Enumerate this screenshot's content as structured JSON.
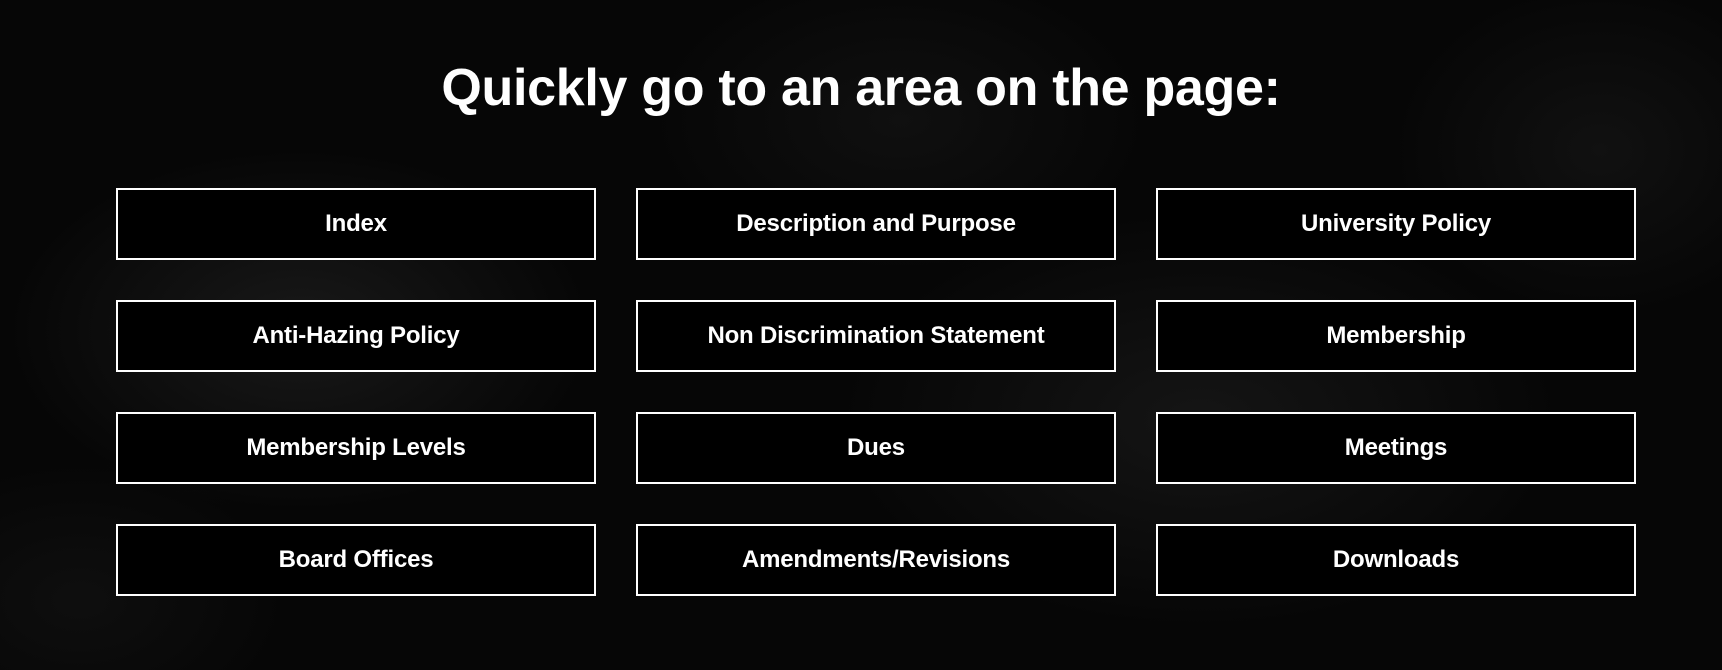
{
  "heading": "Quickly go to an area on the page:",
  "nav_buttons": [
    {
      "label": "Index"
    },
    {
      "label": "Description and Purpose"
    },
    {
      "label": "University Policy"
    },
    {
      "label": "Anti-Hazing Policy"
    },
    {
      "label": "Non Discrimination Statement"
    },
    {
      "label": "Membership"
    },
    {
      "label": "Membership Levels"
    },
    {
      "label": "Dues"
    },
    {
      "label": "Meetings"
    },
    {
      "label": "Board Offices"
    },
    {
      "label": "Amendments/Revisions"
    },
    {
      "label": "Downloads"
    }
  ],
  "colors": {
    "background": "#050505",
    "text": "#ffffff",
    "button_border": "#ffffff",
    "button_fill": "#000000"
  }
}
